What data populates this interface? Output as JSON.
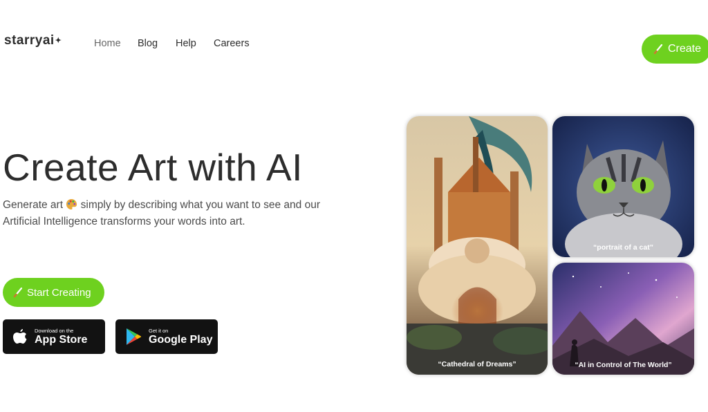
{
  "nav": {
    "logo": "starryai",
    "links": [
      "Home",
      "Blog",
      "Help",
      "Careers"
    ],
    "create_label": "Create"
  },
  "hero": {
    "title": "Create Art with AI",
    "sub_part1": "Generate art",
    "sub_part2": " simply by describing what you want to see and our Artificial Intelligence transforms your words into art.",
    "start_label": "Start Creating"
  },
  "stores": {
    "apple_small": "Download on the",
    "apple_big": "App Store",
    "google_small": "Get it on",
    "google_big": "Google Play"
  },
  "gallery": {
    "cathedral_caption": "“Cathedral of Dreams”",
    "cat_caption": "“portrait of a cat”",
    "world_caption": "“AI in Control of The World”"
  },
  "colors": {
    "accent": "#6ed11f",
    "store_bg": "#121212",
    "text_dark": "#2d2d2d"
  }
}
